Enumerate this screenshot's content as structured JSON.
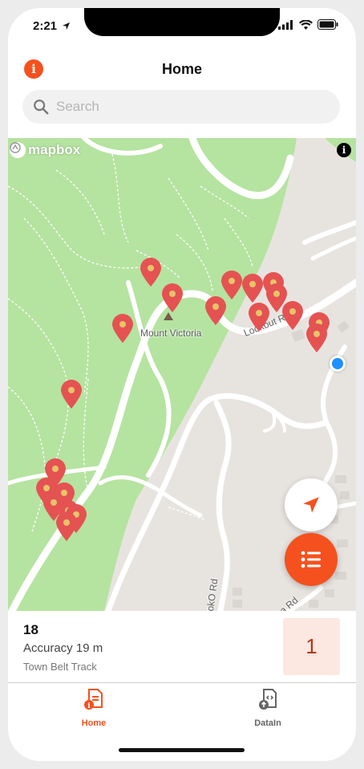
{
  "status": {
    "time": "2:21"
  },
  "header": {
    "title": "Home",
    "info_icon": "i"
  },
  "search": {
    "placeholder": "Search",
    "value": ""
  },
  "map": {
    "attribution_logo": "mapbox",
    "info_icon": "i",
    "labels": {
      "peak": "Mount Victoria",
      "road_lookout": "Lookout R",
      "road_upoko": "pokO Rd",
      "road_a": "a Rd"
    },
    "colors": {
      "park": "#b5e3a0",
      "land": "#e7e4e0",
      "pin": "#e55252",
      "user": "#1e90ff"
    }
  },
  "info_panel": {
    "point_id": "18",
    "accuracy": "Accuracy 19 m",
    "track": "Town Belt Track",
    "count": "1"
  },
  "tabs": [
    {
      "label": "Home",
      "icon": "home-document-icon",
      "active": true
    },
    {
      "label": "DataIn",
      "icon": "data-in-icon",
      "active": false
    }
  ],
  "accent": "#f4511e"
}
